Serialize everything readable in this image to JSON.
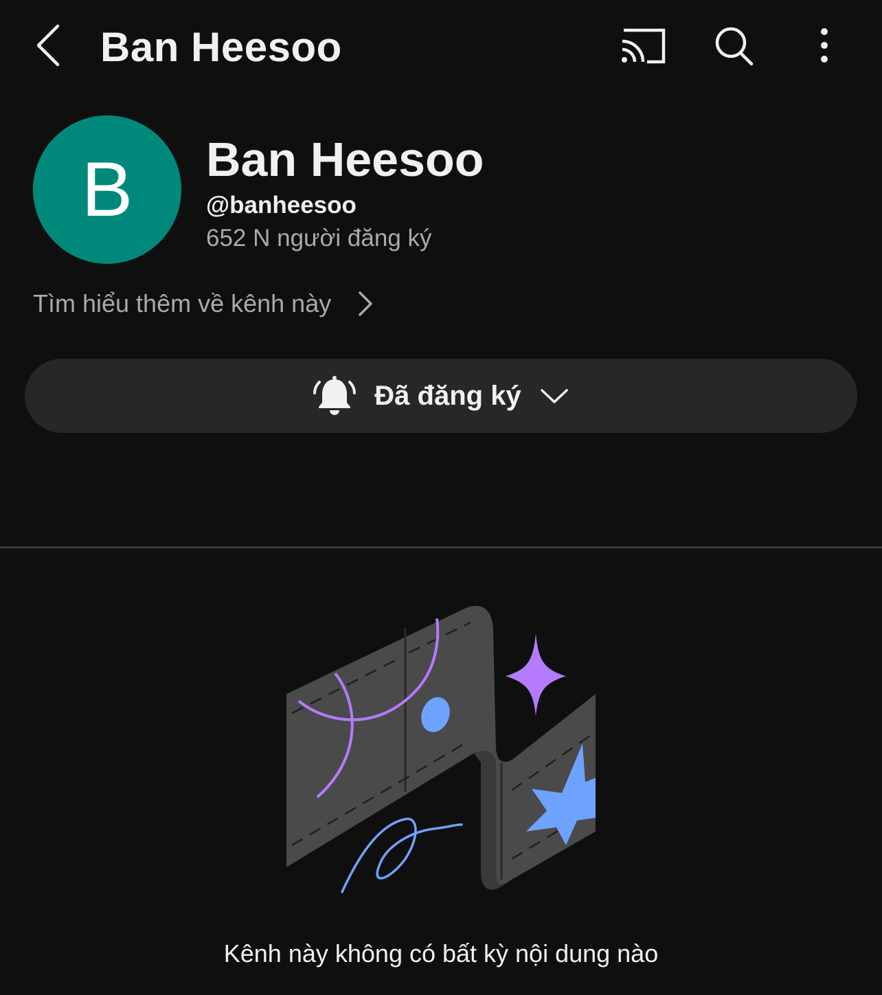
{
  "topbar": {
    "title": "Ban Heesoo",
    "icons": [
      "back-arrow-icon",
      "cast-icon",
      "search-icon",
      "more-vert-icon"
    ]
  },
  "channel": {
    "avatar_letter": "B",
    "avatar_color": "#00897b",
    "name": "Ban Heesoo",
    "handle": "@banheesoo",
    "subscribers": "652 N người đăng ký",
    "about_link": "Tìm hiểu thêm về kênh này"
  },
  "subscribe_button": {
    "label": "Đã đăng ký",
    "icons": [
      "bell-ringing-icon",
      "chevron-down-icon"
    ]
  },
  "empty_state": {
    "message": "Kênh này không có bất kỳ nội dung nào"
  },
  "colors": {
    "background": "#0f0f0f",
    "button_bg": "#272727",
    "secondary_text": "#aaaaaa",
    "accent_purple": "#b57bff",
    "accent_blue": "#6ea2ff"
  }
}
